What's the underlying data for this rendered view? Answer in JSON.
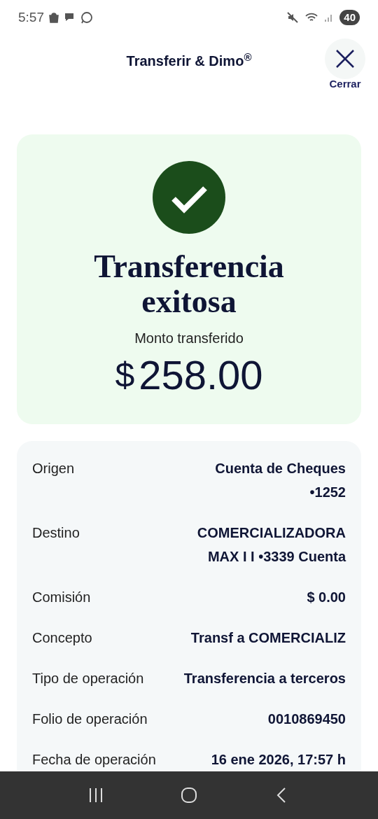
{
  "status_bar": {
    "time": "5:57",
    "battery": "40"
  },
  "header": {
    "title": "Transferir & Dimo$^{®}$",
    "close_label": "Cerrar"
  },
  "result": {
    "title": "Transferencia exitosa",
    "amount_label": "Monto transferido",
    "currency": "$",
    "amount": "258.00"
  },
  "details": [
    {
      "label": "Origen",
      "value": "Cuenta de Cheques •1252"
    },
    {
      "label": "Destino",
      "value": "COMERCIALIZADORA MAX I I •3339 Cuenta"
    },
    {
      "label": "Comisión",
      "value": "$ 0.00"
    },
    {
      "label": "Concepto",
      "value": "Transf a COMERCIALIZ"
    },
    {
      "label": "Tipo de operación",
      "value": "Transferencia a terceros"
    },
    {
      "label": "Folio de operación",
      "value": "0010869450"
    },
    {
      "label": "Fecha de operación",
      "value": "16 ene 2026, 17:57 h"
    }
  ]
}
